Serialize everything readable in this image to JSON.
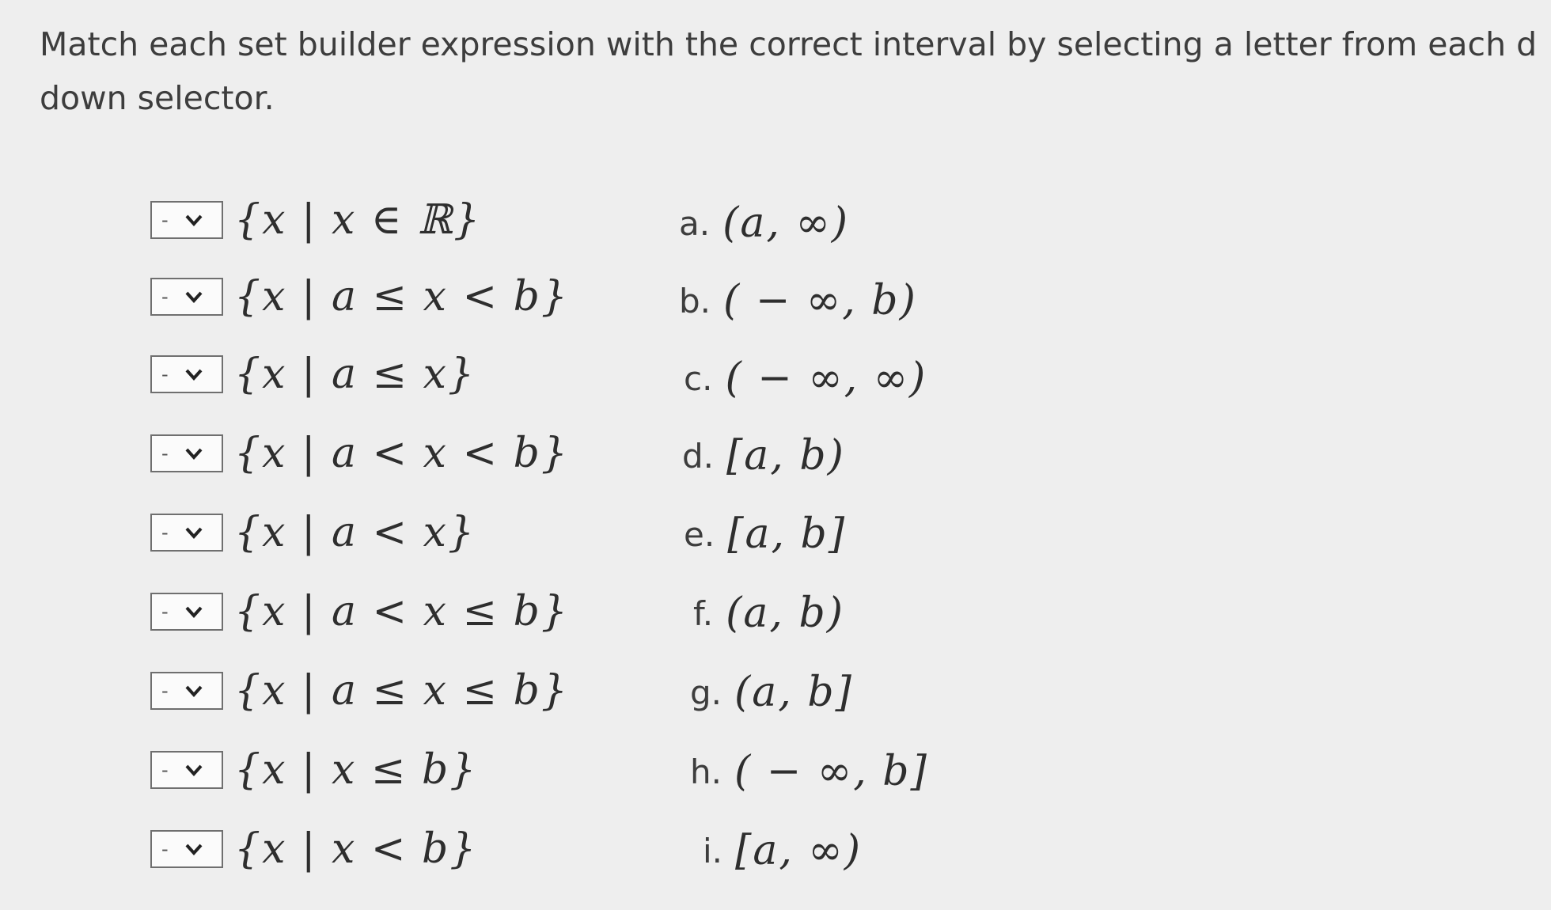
{
  "instructions": {
    "line1": "Match each set builder expression with the correct interval by selecting a letter from each d",
    "line2": "down selector."
  },
  "rows": [
    {
      "selected": "-",
      "expression": "{x | x ∈ ℝ}"
    },
    {
      "selected": "-",
      "expression": "{x | a ≤ x < b}"
    },
    {
      "selected": "-",
      "expression": "{x | a ≤ x}"
    },
    {
      "selected": "-",
      "expression": "{x | a < x < b}"
    },
    {
      "selected": "-",
      "expression": "{x | a < x}"
    },
    {
      "selected": "-",
      "expression": "{x | a < x ≤ b}"
    },
    {
      "selected": "-",
      "expression": "{x | a ≤ x ≤ b}"
    },
    {
      "selected": "-",
      "expression": "{x | x ≤ b}"
    },
    {
      "selected": "-",
      "expression": "{x | x < b}"
    }
  ],
  "options": [
    {
      "letter": "a.",
      "interval": "(a, ∞)"
    },
    {
      "letter": "b.",
      "interval": "( − ∞, b)"
    },
    {
      "letter": "c.",
      "interval": "( − ∞, ∞)"
    },
    {
      "letter": "d.",
      "interval": "[a, b)"
    },
    {
      "letter": "e.",
      "interval": "[a, b]"
    },
    {
      "letter": "f.",
      "interval": "(a, b)"
    },
    {
      "letter": "g.",
      "interval": "(a, b]"
    },
    {
      "letter": "h.",
      "interval": "( − ∞, b]"
    },
    {
      "letter": "i.",
      "interval": "[a, ∞)"
    }
  ],
  "icons": {
    "dropdown": "chevron-down-icon"
  }
}
